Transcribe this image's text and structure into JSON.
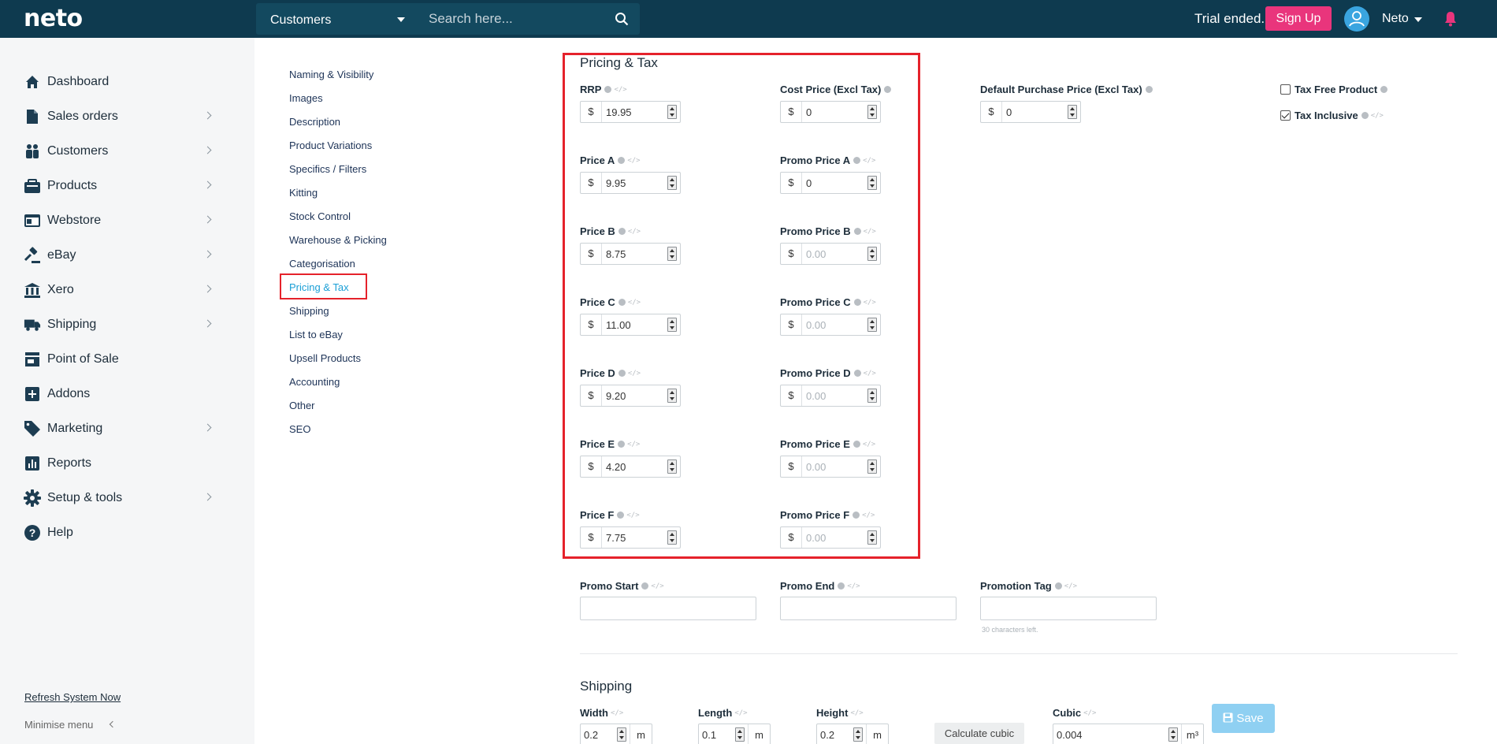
{
  "topbar": {
    "logo": "neto",
    "module": "Customers",
    "search_placeholder": "Search here...",
    "trial": "Trial ended.",
    "signup": "Sign Up",
    "user": "Neto"
  },
  "sidebar": {
    "items": [
      {
        "label": "Dashboard",
        "icon": "home-icon",
        "chevron": false
      },
      {
        "label": "Sales orders",
        "icon": "document-icon",
        "chevron": true
      },
      {
        "label": "Customers",
        "icon": "people-icon",
        "chevron": true
      },
      {
        "label": "Products",
        "icon": "box-icon",
        "chevron": true
      },
      {
        "label": "Webstore",
        "icon": "browser-icon",
        "chevron": true
      },
      {
        "label": "eBay",
        "icon": "gavel-icon",
        "chevron": true
      },
      {
        "label": "Xero",
        "icon": "bank-icon",
        "chevron": true
      },
      {
        "label": "Shipping",
        "icon": "truck-icon",
        "chevron": true
      },
      {
        "label": "Point of Sale",
        "icon": "store-icon",
        "chevron": false
      },
      {
        "label": "Addons",
        "icon": "plus-square-icon",
        "chevron": false
      },
      {
        "label": "Marketing",
        "icon": "tag-icon",
        "chevron": true
      },
      {
        "label": "Reports",
        "icon": "bar-chart-icon",
        "chevron": false
      },
      {
        "label": "Setup & tools",
        "icon": "gear-icon",
        "chevron": true
      },
      {
        "label": "Help",
        "icon": "question-icon",
        "chevron": false
      }
    ],
    "refresh": "Refresh System Now",
    "minimise": "Minimise menu"
  },
  "subnav": [
    "Naming & Visibility",
    "Images",
    "Description",
    "Product Variations",
    "Specifics / Filters",
    "Kitting",
    "Stock Control",
    "Warehouse & Picking",
    "Categorisation",
    "Pricing & Tax",
    "Shipping",
    "List to eBay",
    "Upsell Products",
    "Accounting",
    "Other",
    "SEO"
  ],
  "pricing": {
    "title": "Pricing & Tax",
    "currency": "$",
    "rrp": {
      "label": "RRP",
      "value": "19.95"
    },
    "cost": {
      "label": "Cost Price (Excl Tax)",
      "value": "0"
    },
    "default_purchase": {
      "label": "Default Purchase Price (Excl Tax)",
      "value": "0"
    },
    "tax_free": {
      "label": "Tax Free Product",
      "checked": false
    },
    "tax_inclusive": {
      "label": "Tax Inclusive",
      "checked": true
    },
    "price_levels": [
      {
        "label": "Price A",
        "value": "9.95",
        "promo_label": "Promo Price A",
        "promo_value": "0",
        "promo_placeholder": "0.00"
      },
      {
        "label": "Price B",
        "value": "8.75",
        "promo_label": "Promo Price B",
        "promo_value": "",
        "promo_placeholder": "0.00"
      },
      {
        "label": "Price C",
        "value": "11.00",
        "promo_label": "Promo Price C",
        "promo_value": "",
        "promo_placeholder": "0.00"
      },
      {
        "label": "Price D",
        "value": "9.20",
        "promo_label": "Promo Price D",
        "promo_value": "",
        "promo_placeholder": "0.00"
      },
      {
        "label": "Price E",
        "value": "4.20",
        "promo_label": "Promo Price E",
        "promo_value": "",
        "promo_placeholder": "0.00"
      },
      {
        "label": "Price F",
        "value": "7.75",
        "promo_label": "Promo Price F",
        "promo_value": "",
        "promo_placeholder": "0.00"
      }
    ],
    "promo_start": {
      "label": "Promo Start"
    },
    "promo_end": {
      "label": "Promo End"
    },
    "promo_tag": {
      "label": "Promotion Tag",
      "hint": "30 characters left."
    }
  },
  "shipping": {
    "title": "Shipping",
    "width": {
      "label": "Width",
      "value": "0.2",
      "unit": "m"
    },
    "length": {
      "label": "Length",
      "value": "0.1",
      "unit": "m"
    },
    "height": {
      "label": "Height",
      "value": "0.2",
      "unit": "m"
    },
    "calc": "Calculate cubic",
    "cubic": {
      "label": "Cubic",
      "value": "0.004",
      "unit": "m³"
    }
  },
  "save": "Save",
  "colors": {
    "topbar": "#0e3a4f",
    "accent": "#1a9fd6",
    "signup": "#e9357c",
    "highlight": "#e5222b"
  }
}
